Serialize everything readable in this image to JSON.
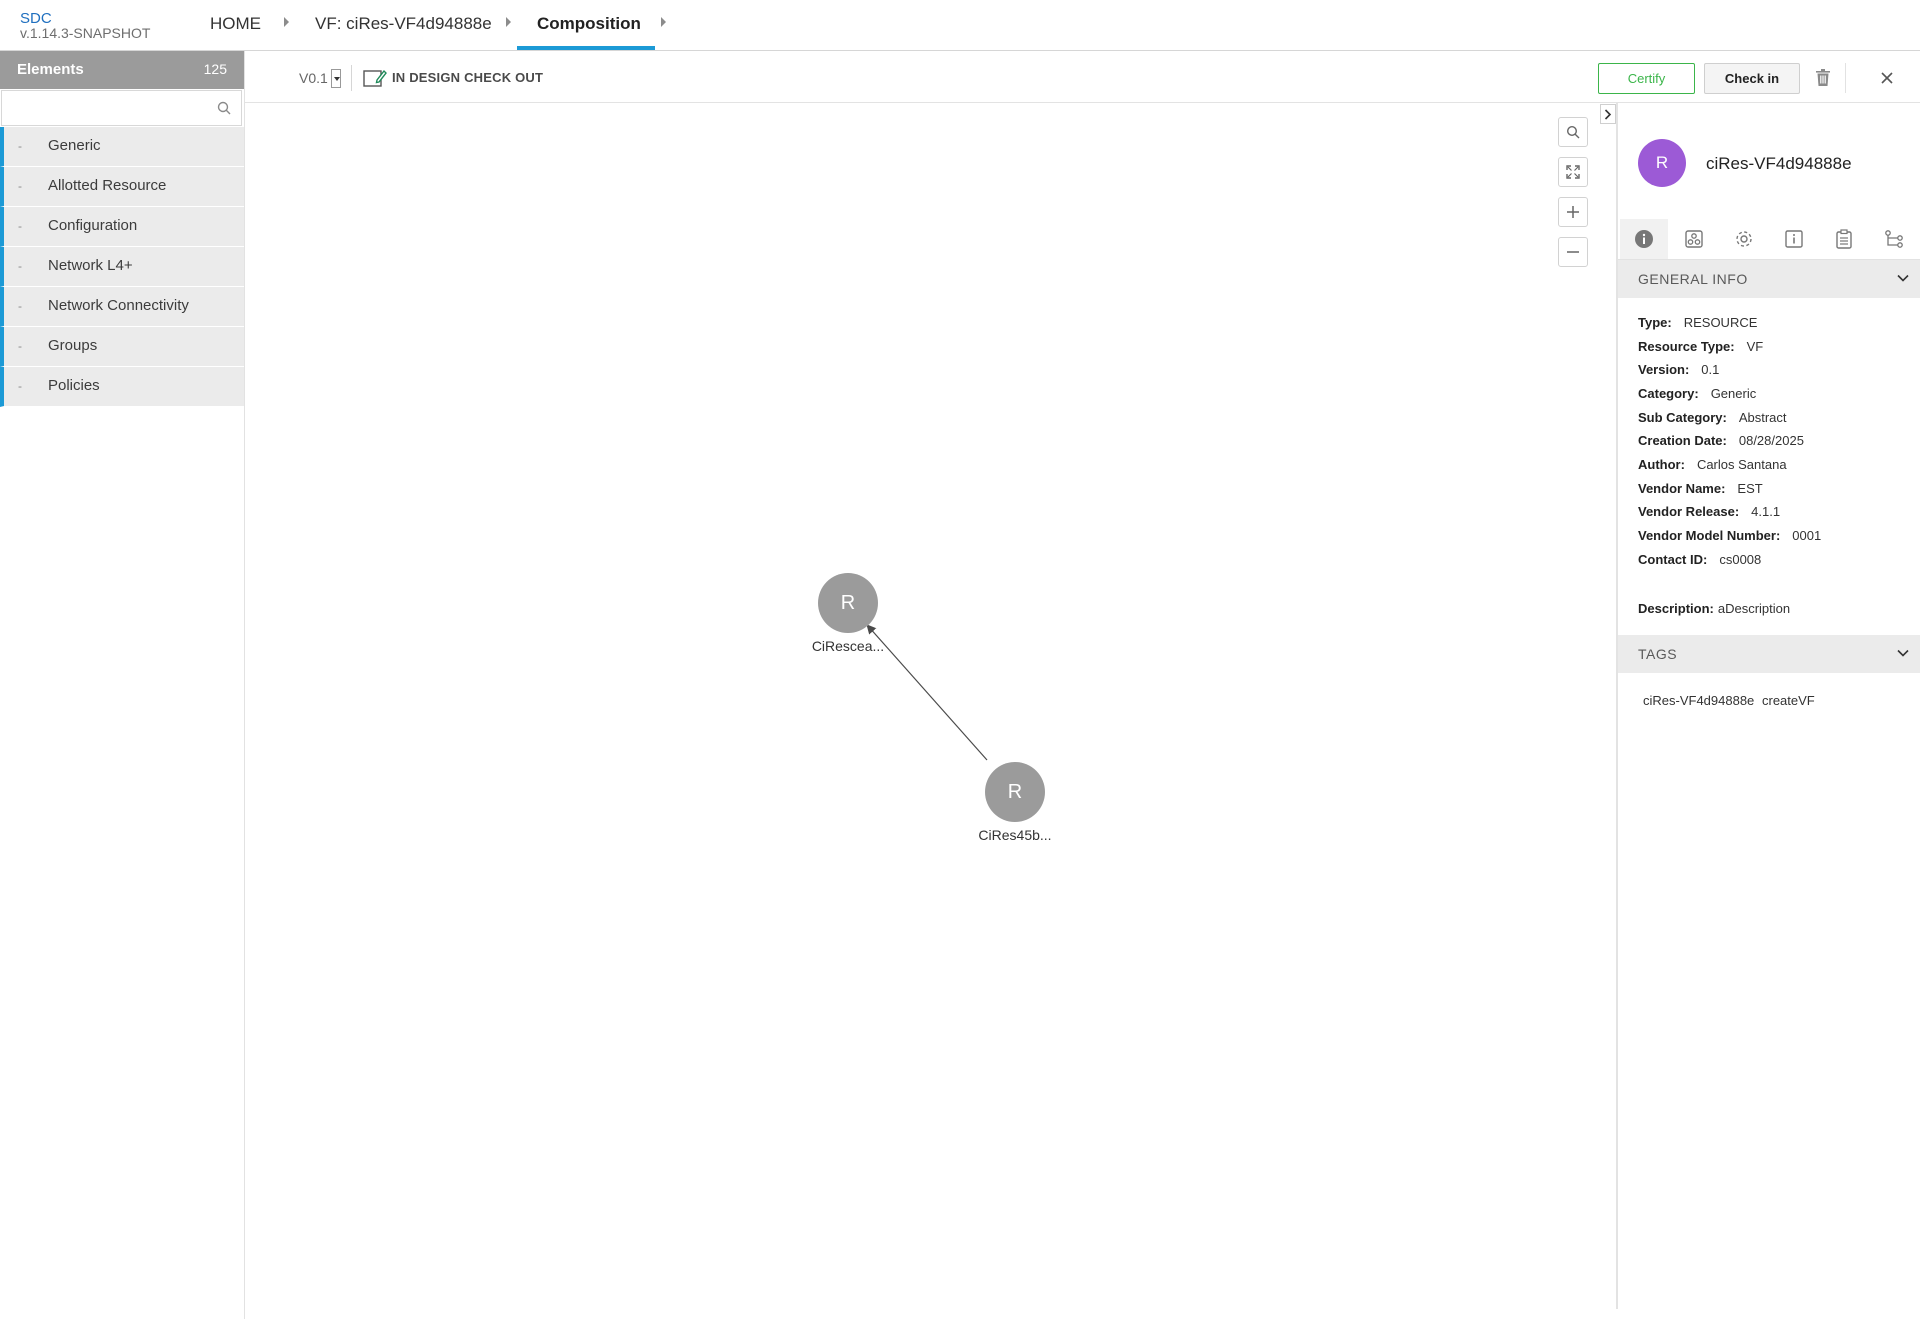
{
  "header": {
    "app_name": "SDC",
    "version": "v.1.14.3-SNAPSHOT",
    "breadcrumbs": [
      {
        "label": "HOME"
      },
      {
        "label": "VF: ciRes-VF4d94888e"
      },
      {
        "label": "Composition"
      }
    ]
  },
  "palette": {
    "title": "Elements",
    "count": "125",
    "search_placeholder": "",
    "categories": [
      {
        "label": "Generic"
      },
      {
        "label": "Allotted Resource"
      },
      {
        "label": "Configuration"
      },
      {
        "label": "Network L4+"
      },
      {
        "label": "Network Connectivity"
      },
      {
        "label": "Groups"
      },
      {
        "label": "Policies"
      }
    ],
    "dash": "-"
  },
  "toolbar": {
    "version": "V0.1",
    "status": "IN DESIGN CHECK OUT",
    "certify_label": "Certify",
    "checkin_label": "Check in"
  },
  "canvas": {
    "nodes": [
      {
        "letter": "R",
        "label": "CiRescea..."
      },
      {
        "letter": "R",
        "label": "CiRes45b..."
      }
    ]
  },
  "details": {
    "avatar_letter": "R",
    "name": "ciRes-VF4d94888e",
    "general_info_title": "GENERAL INFO",
    "fields": [
      {
        "key": "Type:",
        "value": "RESOURCE"
      },
      {
        "key": "Resource Type:",
        "value": "VF"
      },
      {
        "key": "Version:",
        "value": "0.1"
      },
      {
        "key": "Category:",
        "value": "Generic"
      },
      {
        "key": "Sub Category:",
        "value": "Abstract"
      },
      {
        "key": "Creation Date:",
        "value": "08/28/2025"
      },
      {
        "key": "Author:",
        "value": "Carlos Santana"
      },
      {
        "key": "Vendor Name:",
        "value": "EST"
      },
      {
        "key": "Vendor Release:",
        "value": "4.1.1"
      },
      {
        "key": "Vendor Model Number:",
        "value": "0001"
      },
      {
        "key": "Contact ID:",
        "value": "cs0008"
      }
    ],
    "description_key": "Description:",
    "description_value": "aDescription",
    "tags_title": "TAGS",
    "tags": [
      "ciRes-VF4d94888e",
      "createVF"
    ]
  },
  "colors": {
    "accent": "#1c9ad6",
    "certify": "#3bb54a",
    "avatar": "#9c5ad6",
    "node": "#9b9b9b"
  },
  "icons": {
    "search": "search-icon",
    "trash": "trash-icon",
    "close": "close-icon",
    "checkout": "checkout-status-icon",
    "tabs": [
      "info-icon",
      "composition-icon",
      "settings-icon",
      "properties-icon",
      "artifacts-icon",
      "relations-icon"
    ]
  }
}
